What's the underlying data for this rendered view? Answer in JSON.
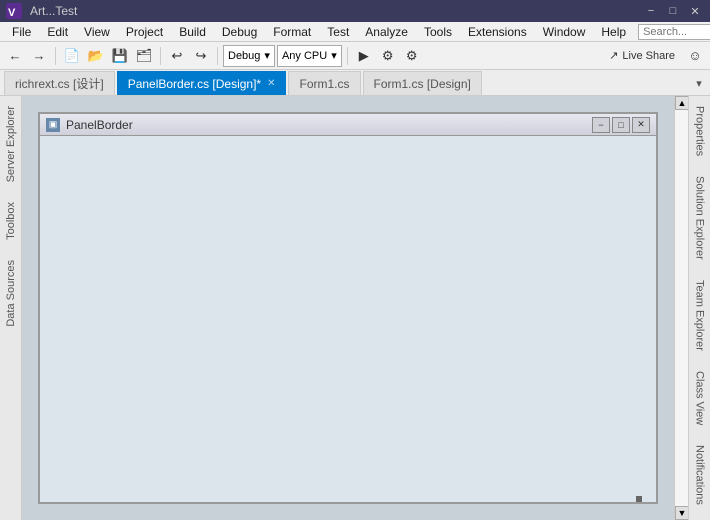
{
  "titlebar": {
    "title": "Art...Test",
    "minimize": "−",
    "maximize": "□",
    "close": "✕"
  },
  "menubar": {
    "items": [
      "File",
      "Edit",
      "View",
      "Project",
      "Build",
      "Debug",
      "Format",
      "Test",
      "Analyze",
      "Tools",
      "Extensions",
      "Window",
      "Help"
    ],
    "search_placeholder": "Search..."
  },
  "toolbar": {
    "debug_config": "Debug",
    "platform": "Any CPU",
    "live_share": "Live Share",
    "back_icon": "←",
    "forward_icon": "→"
  },
  "tabs": [
    {
      "label": "richrext.cs [设计]",
      "active": false,
      "closeable": false
    },
    {
      "label": "PanelBorder.cs [Design]*",
      "active": true,
      "closeable": true
    },
    {
      "label": "Form1.cs",
      "active": false,
      "closeable": false
    },
    {
      "label": "Form1.cs [Design]",
      "active": false,
      "closeable": false
    }
  ],
  "left_sidebar": {
    "panels": [
      "Server Explorer",
      "Toolbox",
      "Data Sources"
    ]
  },
  "right_sidebar": {
    "panels": [
      "Properties",
      "Solution Explorer",
      "Team Explorer",
      "Class View",
      "Notifications"
    ]
  },
  "form": {
    "title": "PanelBorder",
    "icon_text": "▣",
    "minimize": "−",
    "maximize": "□",
    "close": "✕"
  }
}
